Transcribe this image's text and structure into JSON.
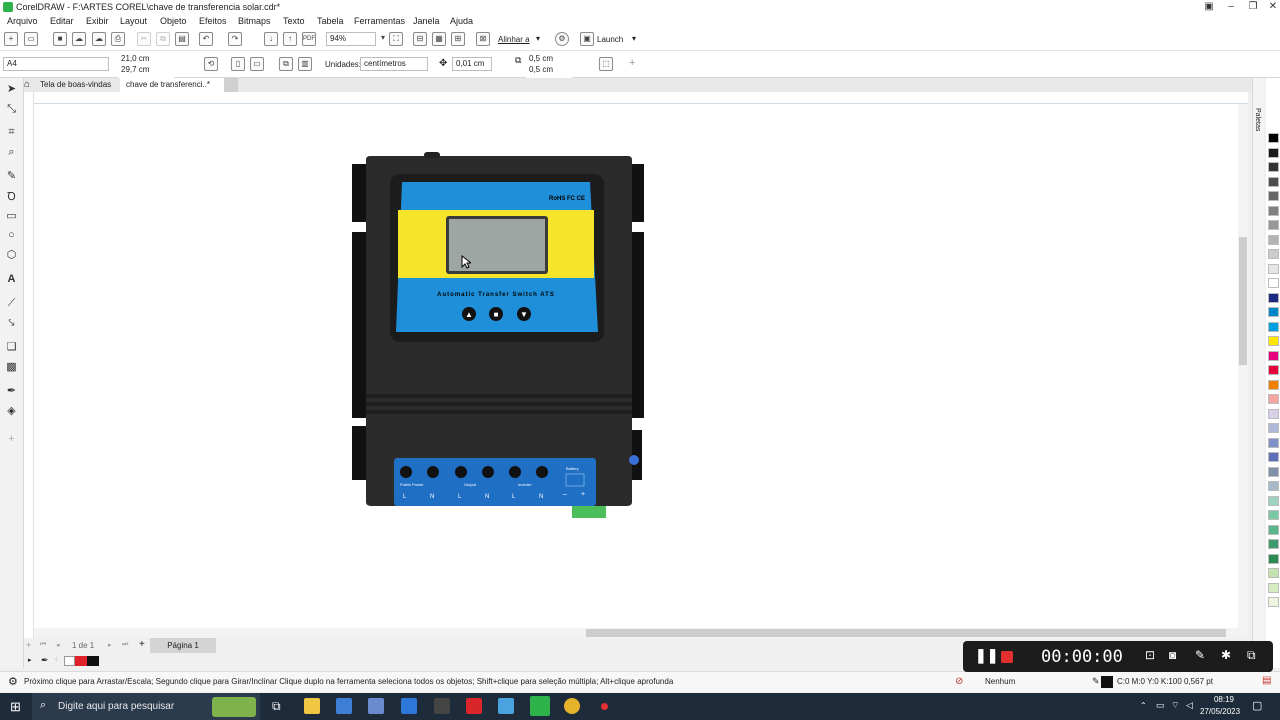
{
  "window": {
    "title": "CorelDRAW - F:\\ARTES COREL\\chave de transferencia solar.cdr*"
  },
  "menu": [
    "Arquivo",
    "Editar",
    "Exibir",
    "Layout",
    "Objeto",
    "Efeitos",
    "Bitmaps",
    "Texto",
    "Tabela",
    "Ferramentas",
    "Janela",
    "Ajuda"
  ],
  "toolbar": {
    "zoom": "94%",
    "align_label": "Alinhar a",
    "launch_label": "Launch"
  },
  "property_bar": {
    "page_size": "A4",
    "width": "21,0 cm",
    "height": "29,7 cm",
    "units_label": "Unidades:",
    "units_value": "centímetros",
    "nudge": "0,01 cm",
    "dup_x": "0,5 cm",
    "dup_y": "0,5 cm"
  },
  "tabs": [
    {
      "label": "Tela de boas-vindas"
    },
    {
      "label": "chave de transferenci..*"
    }
  ],
  "page_nav": {
    "counter": "1 de 1",
    "page_tab": "Página 1"
  },
  "status": {
    "hint": "Próximo clique para Arrastar/Escala; Segundo clique para Girar/Inclinar Clique duplo na ferramenta seleciona todos os objetos; Shift+clique para seleção múltipla; Alt+clique aprofunda",
    "fill": "Nenhum",
    "outline": "C:0 M:0 Y:0 K:100  0,567 pt"
  },
  "recorder": {
    "timer": "00:00:00"
  },
  "device": {
    "certs": "RoHS FC CE",
    "name": "Automatic Transfer Switch ATS",
    "terminal_groups": [
      "Public Power",
      "Output",
      "Inverter",
      "Battery"
    ],
    "terminal_letters": [
      "L",
      "N",
      "L",
      "N",
      "L",
      "N",
      "–",
      "+"
    ]
  },
  "palette_colors": [
    "#000000",
    "#1a1a1a",
    "#333333",
    "#4d4d4d",
    "#666666",
    "#808080",
    "#999999",
    "#b3b3b3",
    "#cccccc",
    "#e6e6e6",
    "#ffffff",
    "#1e2a80",
    "#0087c8",
    "#00a0e0",
    "#ffe600",
    "#e6007e",
    "#e4003a",
    "#f08000",
    "#f4a7a0",
    "#d9d0e8",
    "#b0b8d8",
    "#8090c8",
    "#6070b8",
    "#7f8fa6",
    "#a7b8c8",
    "#9fd3c0",
    "#7bc8a4",
    "#5ab48c",
    "#3f9a70",
    "#2d8a55",
    "#c4e1b0",
    "#d8ecc4",
    "#eef6e2"
  ],
  "taskbar": {
    "search_placeholder": "Digite aqui para pesquisar",
    "time": "08:19",
    "date": "27/05/2023"
  }
}
